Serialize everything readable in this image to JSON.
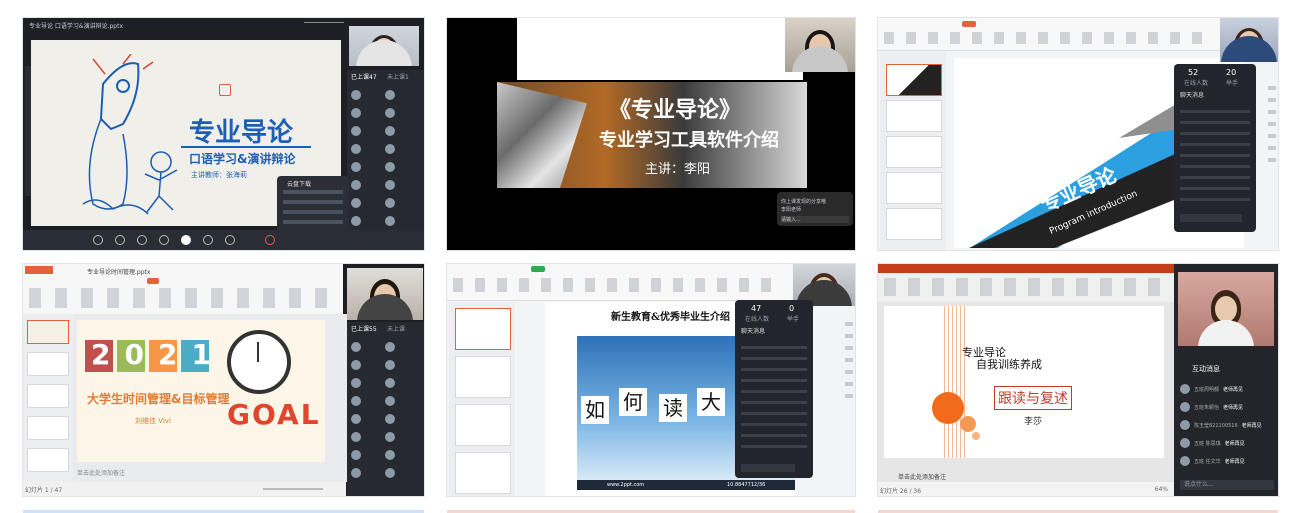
{
  "panels": {
    "p1": {
      "window_title": "专业导论 口语学习&演讲辩论.pptx",
      "slide_title": "专业导论",
      "slide_subtitle": "口语学习&演讲辩论",
      "slide_teacher": "主讲教师：张海莉",
      "online_label": "已上课47",
      "tab_label": "未上课1",
      "chat_header": "云盘下载"
    },
    "p2": {
      "title_line1": "《专业导论》",
      "title_line2": "专业学习工具软件介绍",
      "speaker": "主讲：李阳",
      "chat_line": "请输入...",
      "chat_name": "李阳老师",
      "chat_text": "你上课发现的分享哦"
    },
    "p3": {
      "slide_title": "专业导论",
      "slide_subtitle": "Program introduction",
      "count_online": "52",
      "count_online_label": "在线人数",
      "count_hand": "20",
      "count_hand_label": "举手",
      "chat_header": "聊天消息"
    },
    "p4": {
      "tab_title": "专业导论时间管理.pptx",
      "year": "2021",
      "subtitle": "大学生时间管理&目标管理",
      "goal": "GOAL",
      "author": "刘维佳 Vivi",
      "online_label": "已上课55",
      "tab_label": "未上课",
      "status": "幻灯片 1 / 47",
      "note": "单击此处添加备注"
    },
    "p5": {
      "slide_title": "新生教育&优秀毕业生介绍",
      "chars": [
        "如",
        "何",
        "读",
        "大"
      ],
      "count_a": "47",
      "count_a_label": "在线人数",
      "count_b": "0",
      "count_b_label": "举手",
      "chat_header": "聊天消息",
      "footer_left": "www.2ppt.com",
      "footer_right": "10.8847712/36"
    },
    "p6": {
      "line1": "专业导论",
      "line2": "自我训练养成",
      "box_text": "跟读与复述",
      "author": "李莎",
      "note": "单击此处添加备注",
      "interaction_header": "互动消息",
      "messages": [
        {
          "name": "五班周明都",
          "text": "老师再见"
        },
        {
          "name": "五班朱颖怡",
          "text": "老师再见"
        },
        {
          "name": "陈玉莹821100516",
          "text": "老师再见"
        },
        {
          "name": "五班 陈思琪",
          "text": "老师再见"
        },
        {
          "name": "五班 任文华",
          "text": "老师再见"
        }
      ],
      "input_placeholder": "说点什么...",
      "status_left": "幻灯片 26 / 36",
      "zoom": "64%"
    }
  }
}
